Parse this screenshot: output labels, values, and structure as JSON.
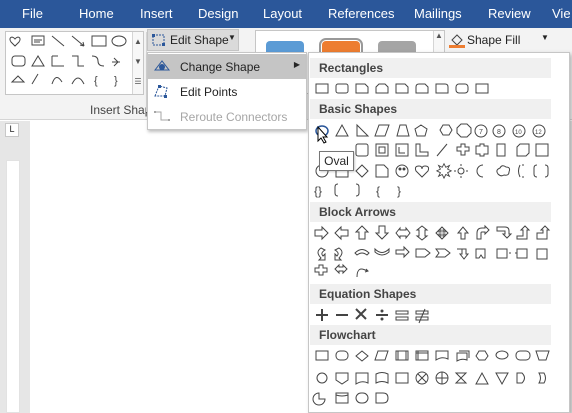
{
  "tabs": [
    "File",
    "Home",
    "Insert",
    "Design",
    "Layout",
    "References",
    "Mailings",
    "Review",
    "Vie"
  ],
  "ribbon": {
    "insert_shapes_group_label": "Insert Shap",
    "edit_shape_label": "Edit Shape",
    "shape_fill_label": "Shape Fill"
  },
  "edit_shape_menu": {
    "items": [
      {
        "label": "Change Shape",
        "icon": "change-shape-icon",
        "submenu": true,
        "enabled": true,
        "highlighted": true
      },
      {
        "label": "Edit Points",
        "icon": "edit-points-icon",
        "submenu": false,
        "enabled": true,
        "highlighted": false
      },
      {
        "label": "Reroute Connectors",
        "icon": "reroute-connectors-icon",
        "submenu": false,
        "enabled": false,
        "highlighted": false
      }
    ]
  },
  "shape_panel": {
    "categories": [
      {
        "name": "Rectangles"
      },
      {
        "name": "Basic Shapes"
      },
      {
        "name": "Block Arrows"
      },
      {
        "name": "Equation Shapes"
      },
      {
        "name": "Flowchart"
      }
    ]
  },
  "tooltip": "Oval",
  "ruler": {
    "corner_symbol": "L"
  },
  "colors": {
    "tabbar": "#2b579a",
    "menu_highlight": "#c5c5c5",
    "style_blue": "#5b9bd5",
    "style_orange": "#ed7d31",
    "style_gray": "#a5a5a5"
  }
}
